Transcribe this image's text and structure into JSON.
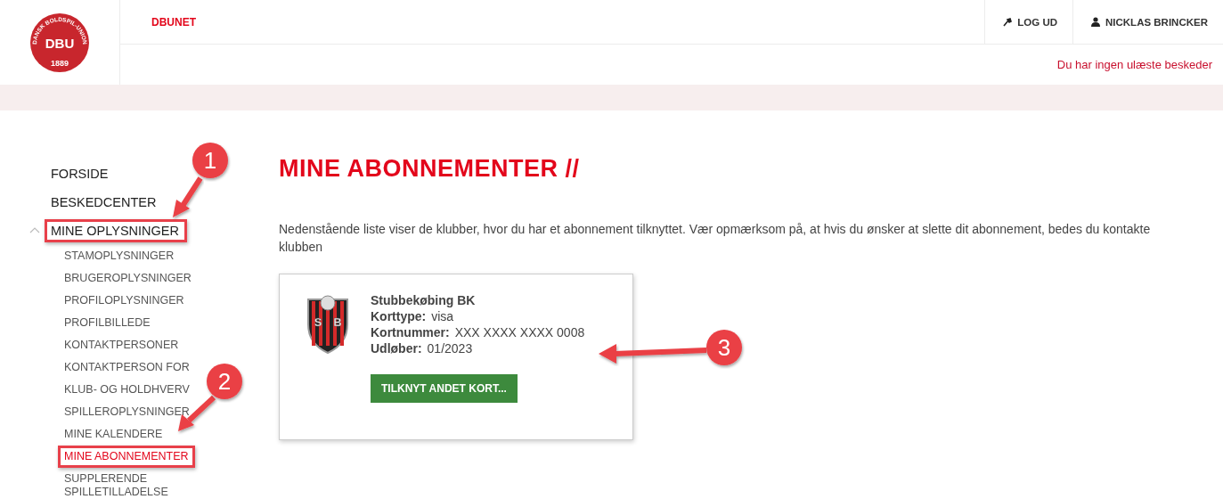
{
  "logo": {
    "center": "DBU",
    "ring": "DANSK BOLDSPIL-UNION",
    "year": "1889"
  },
  "header": {
    "brand": "DBUNET",
    "actions": [
      {
        "kind": "logout",
        "label": "LOG UD"
      },
      {
        "kind": "user",
        "label": "NICKLAS BRINCKER"
      }
    ],
    "message": "Du har ingen ulæste beskeder"
  },
  "sidebar": {
    "items": [
      {
        "label": "FORSIDE",
        "selected": false,
        "highlighted": false
      },
      {
        "label": "BESKEDCENTER",
        "selected": false,
        "highlighted": false
      },
      {
        "label": "MINE OPLYSNINGER",
        "selected": false,
        "highlighted": true,
        "expanded": true,
        "children": [
          {
            "label": "STAMOPLYSNINGER",
            "selected": false,
            "highlighted": false
          },
          {
            "label": "BRUGEROPLYSNINGER",
            "selected": false,
            "highlighted": false
          },
          {
            "label": "PROFILOPLYSNINGER",
            "selected": false,
            "highlighted": false
          },
          {
            "label": "PROFILBILLEDE",
            "selected": false,
            "highlighted": false
          },
          {
            "label": "KONTAKTPERSONER",
            "selected": false,
            "highlighted": false
          },
          {
            "label": "KONTAKTPERSON FOR",
            "selected": false,
            "highlighted": false
          },
          {
            "label": "KLUB- OG HOLDHVERV",
            "selected": false,
            "highlighted": false
          },
          {
            "label": "SPILLEROPLYSNINGER",
            "selected": false,
            "highlighted": false
          },
          {
            "label": "MINE KALENDERE",
            "selected": false,
            "highlighted": false
          },
          {
            "label": "MINE ABONNEMENTER",
            "selected": true,
            "highlighted": true
          },
          {
            "label": "SUPPLERENDE SPILLETILLADELSE",
            "selected": false,
            "highlighted": false
          }
        ]
      }
    ]
  },
  "content": {
    "title": "MINE ABONNEMENTER //",
    "intro": "Nedenstående liste viser de klubber, hvor du har et abonnement tilknyttet. Vær opmærksom på, at hvis du ønsker at slette dit abonnement, bedes du kontakte klubben",
    "subscriptions": [
      {
        "club": "Stubbekøbing BK",
        "crest_letters": [
          "S",
          "B"
        ],
        "fields": [
          {
            "label": "Korttype:",
            "value": "visa"
          },
          {
            "label": "Kortnummer:",
            "value": "XXX XXXX XXXX 0008"
          },
          {
            "label": "Udløber:",
            "value": "01/2023"
          }
        ],
        "button": "TILKNYT ANDET KORT..."
      }
    ]
  },
  "annotations": [
    "1",
    "2",
    "3"
  ]
}
